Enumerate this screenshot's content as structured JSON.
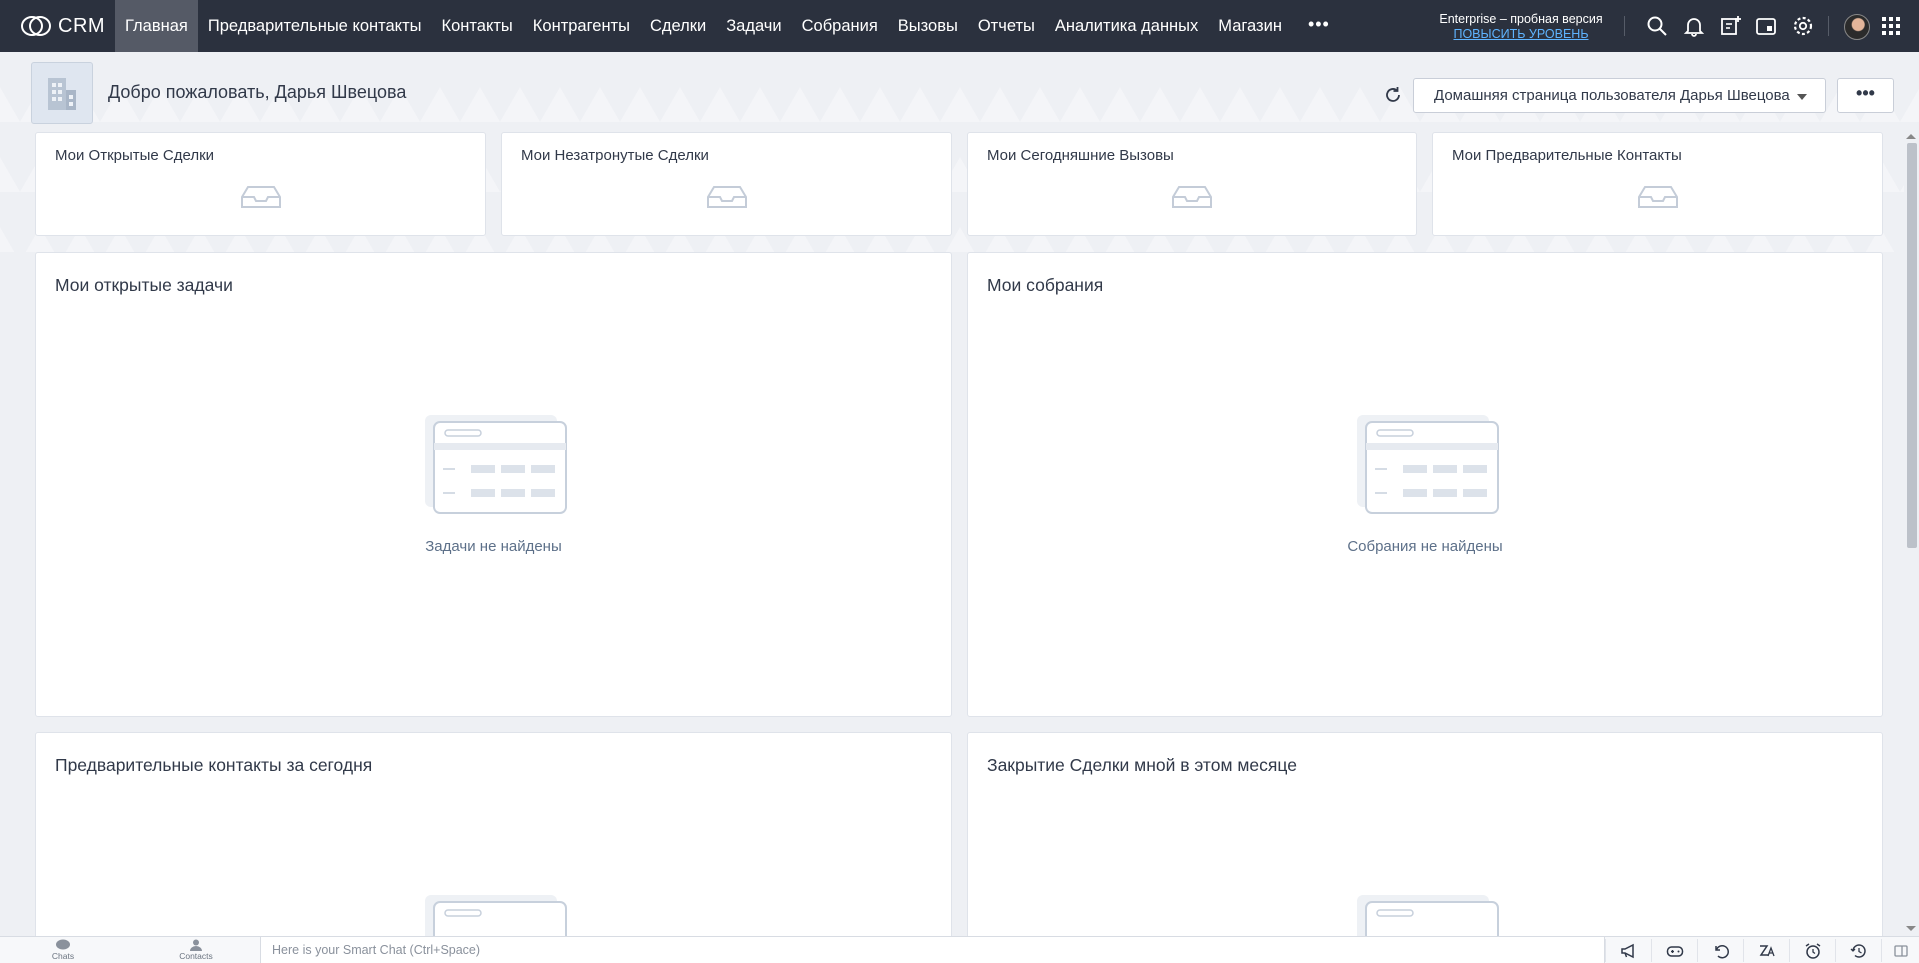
{
  "app": {
    "logo_text": "CRM"
  },
  "nav": {
    "items": [
      {
        "label": "Главная",
        "active": true
      },
      {
        "label": "Предварительные контакты"
      },
      {
        "label": "Контакты"
      },
      {
        "label": "Контрагенты"
      },
      {
        "label": "Сделки"
      },
      {
        "label": "Задачи"
      },
      {
        "label": "Собрания"
      },
      {
        "label": "Вызовы"
      },
      {
        "label": "Отчеты"
      },
      {
        "label": "Аналитика данных"
      },
      {
        "label": "Магазин"
      }
    ],
    "more_label": "•••"
  },
  "plan": {
    "name": "Enterprise – пробная версия",
    "upgrade": "ПОВЫСИТЬ УРОВЕНЬ"
  },
  "top_icons": [
    "search-icon",
    "bell-icon",
    "add-note-icon",
    "calendar-icon",
    "gear-icon",
    "avatar",
    "apps-grid-icon"
  ],
  "header": {
    "welcome": "Добро пожаловать, Дарья Швецова",
    "home_select_value": "Домашняя страница пользователя Дарья Швецова",
    "more_label": "•••"
  },
  "kpis": [
    {
      "title": "Мои Открытые Сделки"
    },
    {
      "title": "Мои Незатронутые Сделки"
    },
    {
      "title": "Мои Сегодняшние Вызовы"
    },
    {
      "title": "Мои Предварительные Контакты"
    }
  ],
  "panels": [
    {
      "title": "Мои открытые задачи",
      "empty": "Задачи не найдены"
    },
    {
      "title": "Мои собрания",
      "empty": "Собрания не найдены"
    },
    {
      "title": "Предварительные контакты за сегодня",
      "empty": ""
    },
    {
      "title": "Закрытие Сделки мной в этом месяце",
      "empty": ""
    }
  ],
  "bottombar": {
    "chats_label": "Chats",
    "contacts_label": "Contacts",
    "smart_chat_placeholder": "Here is your Smart Chat (Ctrl+Space)",
    "icons": [
      "megaphone-icon",
      "gamepad-icon",
      "history-icon",
      "translate-icon",
      "alarm-icon",
      "time-machine-icon",
      "sidebar-toggle-icon"
    ]
  },
  "colors": {
    "topbar": "#2b313e",
    "active_tab": "#555a66",
    "upgrade_link": "#5fb4ff",
    "background": "#eef0f4"
  }
}
